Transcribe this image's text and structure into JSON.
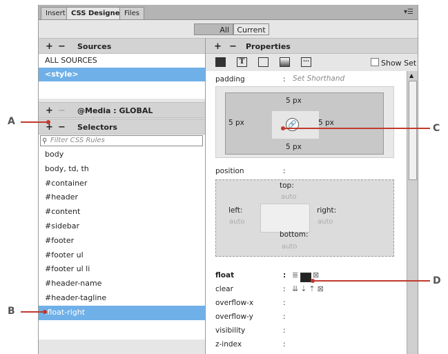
{
  "tabs": [
    {
      "label": "Insert",
      "active": false
    },
    {
      "label": "CSS Designer",
      "active": true
    },
    {
      "label": "Files",
      "active": false
    }
  ],
  "tab_menu_icon": "menu-icon",
  "toggle": {
    "all": "All",
    "current": "Current"
  },
  "sources": {
    "plus": "+",
    "minus": "−",
    "title": "Sources",
    "items": [
      "ALL SOURCES",
      "<style>"
    ],
    "selected_index": 1
  },
  "media": {
    "plus": "+",
    "minus": "−",
    "title": "@Media : GLOBAL"
  },
  "selectors": {
    "plus": "+",
    "minus": "−",
    "title": "Selectors",
    "filter_placeholder": "Filter CSS Rules",
    "rules": [
      "body",
      "body, td, th",
      "#container",
      "#header",
      "#content",
      "#sidebar",
      "#footer",
      "#footer ul",
      "#footer ul li",
      "#header-name",
      "#header-tagline",
      ".float-right"
    ],
    "selected_index": 11
  },
  "properties": {
    "plus": "+",
    "minus": "−",
    "title": "Properties",
    "show_set": "Show Set",
    "padding_label": "padding",
    "colon": ":",
    "shorthand": "Set Shorthand",
    "pad_top": "5 px",
    "pad_left": "5 px",
    "pad_right": "5 px",
    "pad_bottom": "5 px",
    "position_label": "position",
    "pos_top_label": "top:",
    "pos_top_val": "auto",
    "pos_left_label": "left:",
    "pos_left_val": "auto",
    "pos_right_label": "right:",
    "pos_right_val": "auto",
    "pos_bottom_label": "bottom:",
    "pos_bottom_val": "auto",
    "float_label": "float",
    "clear_label": "clear",
    "overflow_x_label": "overflow-x",
    "overflow_y_label": "overflow-y",
    "visibility_label": "visibility",
    "z_index_label": "z-index"
  },
  "callouts": {
    "a": "A",
    "b": "B",
    "c": "C",
    "d": "D"
  },
  "colors": {
    "accent": "#6fb0e8",
    "callout": "#c0392b"
  }
}
